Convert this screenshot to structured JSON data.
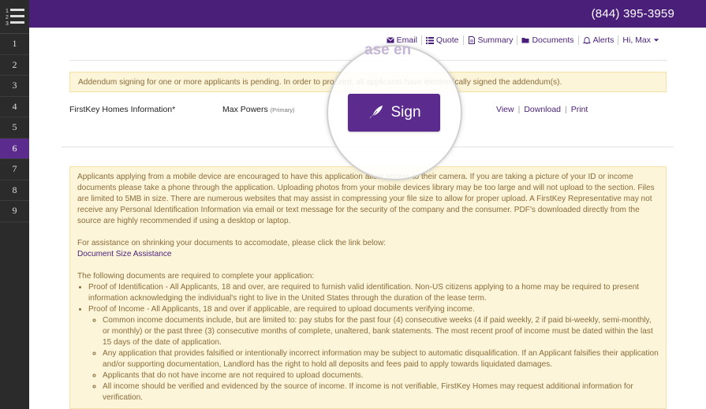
{
  "sidebar": {
    "logo_icon": "numbered-list-icon",
    "steps": [
      "1",
      "2",
      "3",
      "4",
      "5",
      "6",
      "7",
      "8",
      "9"
    ],
    "active_step": "6"
  },
  "header": {
    "phone": "(844) 395-3959"
  },
  "nav": {
    "email": "Email",
    "quote": "Quote",
    "summary": "Summary",
    "documents": "Documents",
    "alerts": "Alerts",
    "user": "Hi, Max"
  },
  "background_title": "ase en",
  "alert_pending": "Addendum signing for one or more applicants is pending. In order to proceed, all applicants have electronically signed the addendum(s).",
  "document": {
    "name": "FirstKey Homes Information*",
    "applicant": "Max Powers",
    "applicant_role": "(Primary)",
    "sign_label": "Sign",
    "view": "View",
    "download": "Download",
    "print": "Print"
  },
  "info": {
    "mobile_notice": "Applicants applying from a mobile device are encouraged to have this application allow access to their camera. If you are taking a picture of your ID or income documents please take a phone through the application. Uploading photos from your mobile devices library may be too large and will not upload to the section. Files are limited to 5MB in size. There are numerous websites that may assist in compressing your file size to allow for proper upload. A FirstKey Representative may not receive any Personal Identification Information via email or text message for the security of the company and the consumer. PDF's downloaded directly from the source are highly recommended if using a desktop or laptop.",
    "assist_text": "For assistance on shrinking your documents to accomodate, please click the link below:",
    "assist_link": "Document Size Assistance",
    "required_intro": "The following documents are required to complete your application:",
    "identification": "Proof of Identification - All Applicants, 18 and over, are required to furnish valid identification. Non-US citizens applying to a home may be required to present information acknowledging the individual's right to live in the United States through the duration of the lease term.",
    "income": "Proof of Income - All Applicants, 18 and over if applicable, are required to upload documents verifying income.",
    "income_docs": "Common income documents include, but are limited to: pay stubs for the past four (4) consecutive weeks (4 if paid weekly, 2 if paid bi-weekly, semi-monthly, or monthly) or the past three (3) consecutive months of complete, unaltered, bank statements. The most recent proof of income must be dated within the last 15 days of the date of application.",
    "falsified": "Any application that provides falsified or intentionally incorrect information may be subject to automatic disqualification. If an Applicant falsifies their application and/or supporting documentation, Landlord has the right to hold all deposits and fees paid to apply towards liquidated damages.",
    "no_income": "Applicants that do not have income are not required to upload documents.",
    "verified": "All income should be verified and evidenced by the source of income. If income is not verifiable, FirstKey Homes may request additional information for verification."
  }
}
